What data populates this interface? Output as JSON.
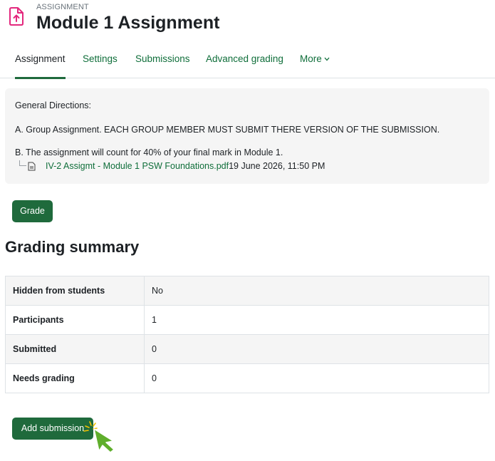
{
  "header": {
    "module_type": "ASSIGNMENT",
    "title": "Module 1 Assignment",
    "icon": "assignment-upload-icon",
    "accent_color": "#e3287d"
  },
  "tabs": [
    {
      "label": "Assignment",
      "active": true
    },
    {
      "label": "Settings",
      "active": false
    },
    {
      "label": "Submissions",
      "active": false
    },
    {
      "label": "Advanced grading",
      "active": false
    },
    {
      "label": "More",
      "active": false
    }
  ],
  "intro": {
    "heading": "General Directions:",
    "line_a": "A. Group Assignment. EACH GROUP MEMBER MUST SUBMIT THERE VERSION OF THE SUBMISSION.",
    "line_b": "B. The assignment will count for 40% of your final mark in Module 1.",
    "file_name": "IV-2 Assigmt - Module 1 PSW Foundations.pdf",
    "file_date": "19 June 2026, 11:50 PM"
  },
  "buttons": {
    "grade": "Grade",
    "add_submission": "Add submission"
  },
  "grading_summary": {
    "title": "Grading summary",
    "rows": [
      {
        "label": "Hidden from students",
        "value": "No"
      },
      {
        "label": "Participants",
        "value": "1"
      },
      {
        "label": "Submitted",
        "value": "0"
      },
      {
        "label": "Needs grading",
        "value": "0"
      }
    ]
  },
  "colors": {
    "primary_button": "#1f6a3c",
    "link": "#0f6e3a",
    "cursor": "#5fae2c"
  }
}
